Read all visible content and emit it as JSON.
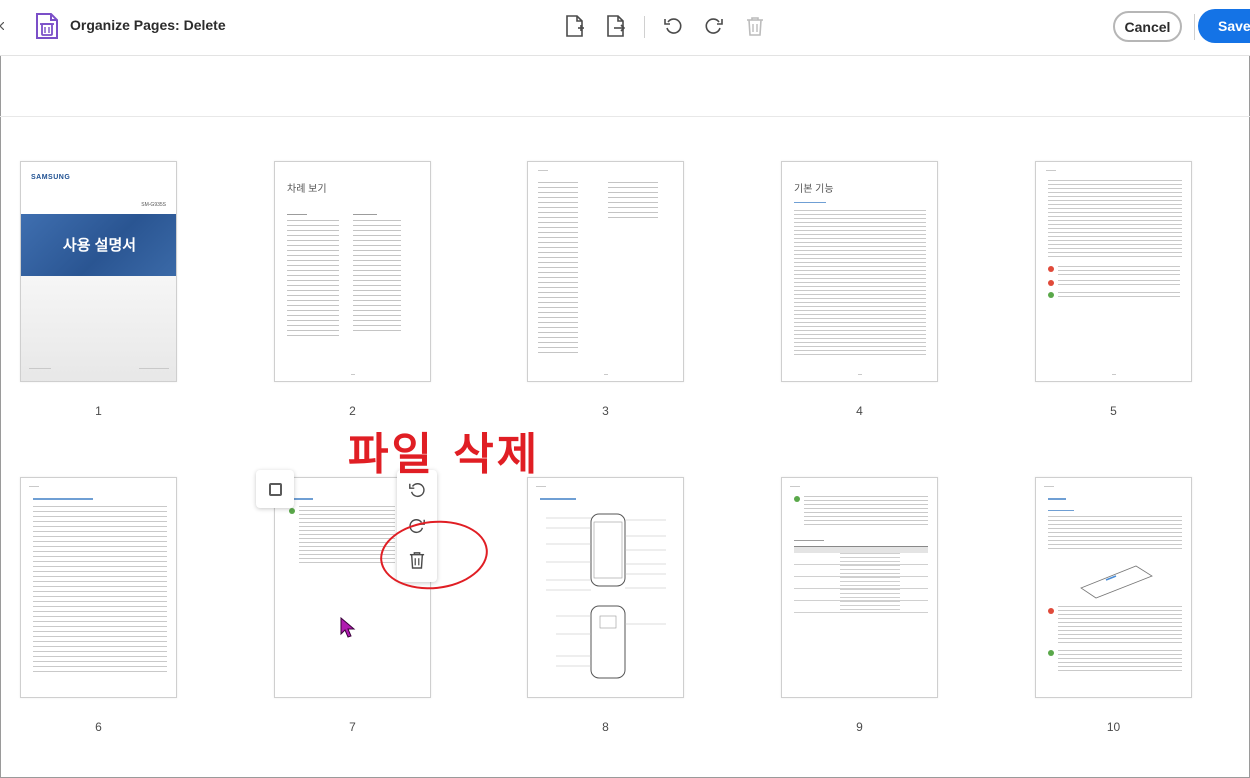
{
  "toolbar": {
    "app_icon": "organize-pages-icon",
    "title": "Organize Pages: Delete",
    "buttons": [
      {
        "name": "insert-page-icon",
        "label": ""
      },
      {
        "name": "extract-page-icon",
        "label": ""
      },
      {
        "name": "rotate-left-icon",
        "label": ""
      },
      {
        "name": "rotate-right-icon",
        "label": ""
      },
      {
        "name": "delete-icon",
        "label": ""
      }
    ],
    "cancel_label": "Cancel",
    "save_label": "Save",
    "accent_color": "#1473e6"
  },
  "pages": [
    {
      "number": "1",
      "cover_brand": "SAMSUNG",
      "cover_model": "SM-G935S",
      "cover_title": "사용 설명서"
    },
    {
      "number": "2",
      "heading": "차례 보기"
    },
    {
      "number": "3"
    },
    {
      "number": "4",
      "heading": "기본 기능"
    },
    {
      "number": "5"
    },
    {
      "number": "6"
    },
    {
      "number": "7"
    },
    {
      "number": "8"
    },
    {
      "number": "9"
    },
    {
      "number": "10"
    }
  ],
  "hover": {
    "page": "7",
    "actions": [
      "rotate-left-icon",
      "rotate-right-icon",
      "trash-icon"
    ]
  },
  "annotation": {
    "text": "파일 삭제",
    "color": "#e01e24"
  }
}
